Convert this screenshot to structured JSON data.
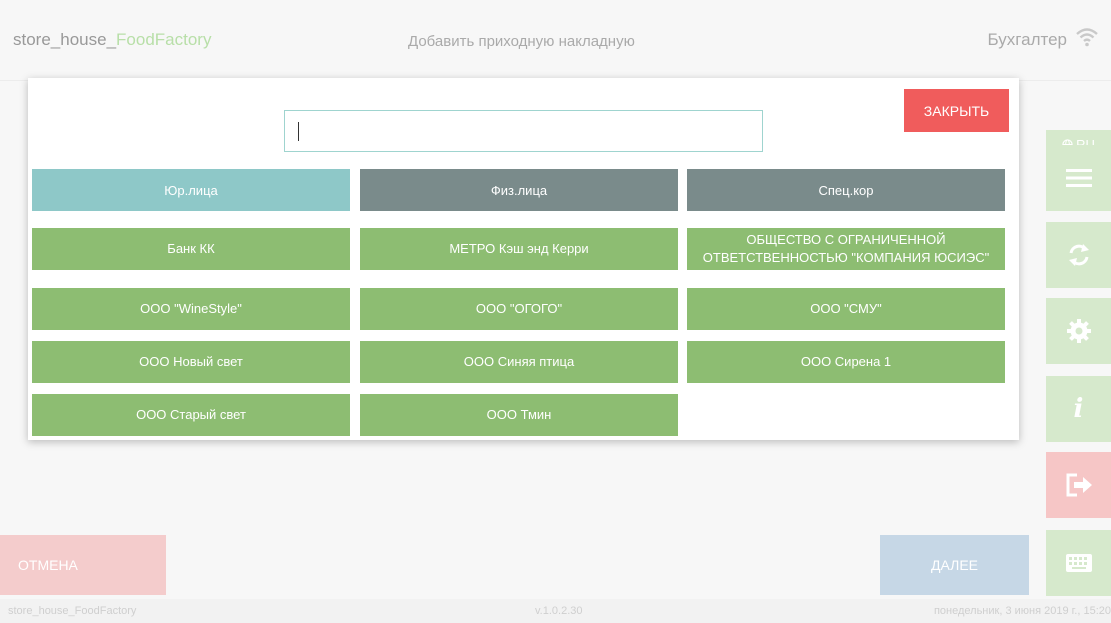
{
  "header": {
    "app_prefix": "store_house_",
    "app_accent": "FoodFactory",
    "screen_title": "Добавить приходную накладную",
    "user_role": "Бухгалтер"
  },
  "sidebar": {
    "lang_label": "RU",
    "items": [
      {
        "icon": "menu-icon"
      },
      {
        "icon": "sync-icon"
      },
      {
        "icon": "gear-icon"
      },
      {
        "icon": "info-icon"
      },
      {
        "icon": "logout-icon"
      },
      {
        "icon": "keyboard-icon"
      }
    ]
  },
  "modal": {
    "search_value": "",
    "close_label": "ЗАКРЫТЬ",
    "tabs": [
      {
        "label": "Юр.лица",
        "active": true
      },
      {
        "label": "Физ.лица",
        "active": false
      },
      {
        "label": "Спец.кор",
        "active": false
      }
    ],
    "companies": [
      {
        "label": "Банк КК"
      },
      {
        "label": "МЕТРО Кэш энд Керри"
      },
      {
        "label": "ОБЩЕСТВО С ОГРАНИЧЕННОЙ ОТВЕТСТВЕННОСТЬЮ \"КОМПАНИЯ ЮСИЭС\""
      },
      {
        "label": "ООО \"WineStyle\""
      },
      {
        "label": "ООО \"ОГОГО\""
      },
      {
        "label": "ООО \"СМУ\""
      },
      {
        "label": "ООО Новый свет"
      },
      {
        "label": "ООО Синяя птица"
      },
      {
        "label": "ООО Сирена 1"
      },
      {
        "label": "ООО Старый свет"
      },
      {
        "label": "ООО Тмин"
      }
    ]
  },
  "buttons": {
    "cancel_label": "ОТМЕНА",
    "next_label": "ДАЛЕЕ"
  },
  "footer": {
    "left": "store_house_FoodFactory",
    "version": "v.1.0.2.30",
    "datetime": "понедельник, 3 июня 2019 г., 15:20"
  },
  "colors": {
    "close": "#f05c5c",
    "tab_active": "#8ec8c8",
    "tab_inactive": "#7a8b8b",
    "company": "#8dbd72",
    "sidebar": "#d6e9cc"
  }
}
